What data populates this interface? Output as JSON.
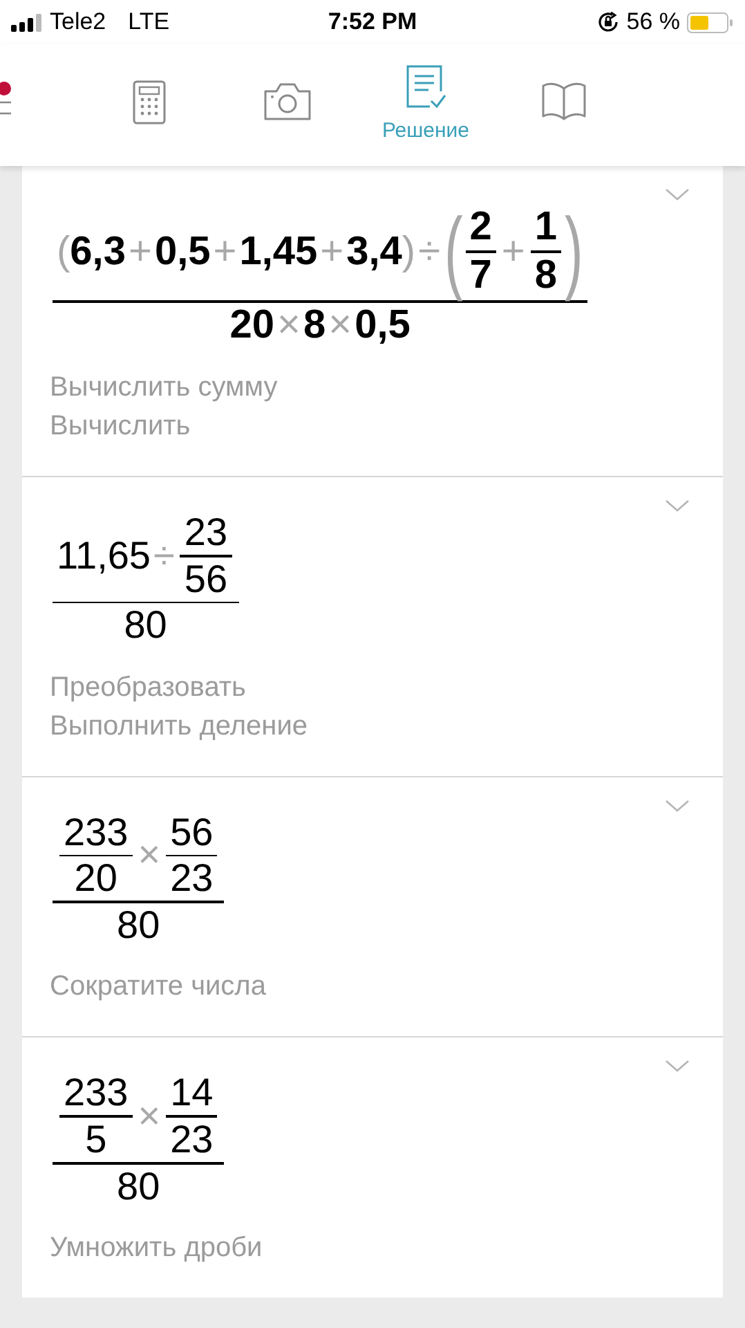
{
  "status_bar": {
    "carrier": "Tele2",
    "network": "LTE",
    "time": "7:52 PM",
    "battery": "56 %"
  },
  "toolbar": [
    {
      "kind": "menu",
      "selected": false
    },
    {
      "kind": "calculator",
      "selected": false
    },
    {
      "kind": "camera",
      "selected": false
    },
    {
      "kind": "solution",
      "label": "Решение",
      "selected": true
    },
    {
      "kind": "book",
      "selected": false
    }
  ],
  "steps": [
    {
      "bold": true,
      "expression": {
        "kind": "fraction",
        "num": [
          {
            "kind": "paren",
            "open": "(",
            "close": ")",
            "items": [
              {
                "kind": "number",
                "text": "6,3"
              },
              {
                "kind": "operator",
                "text": "+"
              },
              {
                "kind": "number",
                "text": "0,5"
              },
              {
                "kind": "operator",
                "text": "+"
              },
              {
                "kind": "number",
                "text": "1,45"
              },
              {
                "kind": "operator",
                "text": "+"
              },
              {
                "kind": "number",
                "text": "3,4"
              }
            ]
          },
          {
            "kind": "operator",
            "text": "÷"
          },
          {
            "kind": "paren",
            "open": "(",
            "close": ")",
            "items": [
              {
                "kind": "fraction",
                "num": [
                  {
                    "kind": "number",
                    "text": "2"
                  }
                ],
                "den": [
                  {
                    "kind": "number",
                    "text": "7"
                  }
                ]
              },
              {
                "kind": "operator",
                "text": "+"
              },
              {
                "kind": "fraction",
                "num": [
                  {
                    "kind": "number",
                    "text": "1"
                  }
                ],
                "den": [
                  {
                    "kind": "number",
                    "text": "8"
                  }
                ]
              }
            ]
          }
        ],
        "den": [
          {
            "kind": "number",
            "text": "20"
          },
          {
            "kind": "operator",
            "text": "×"
          },
          {
            "kind": "number",
            "text": "8"
          },
          {
            "kind": "operator",
            "text": "×"
          },
          {
            "kind": "number",
            "text": "0,5"
          }
        ]
      },
      "hints": [
        "Вычислить сумму",
        "Вычислить"
      ]
    },
    {
      "bold": false,
      "expression": {
        "kind": "fraction",
        "num": [
          {
            "kind": "number",
            "text": "11,65"
          },
          {
            "kind": "operator",
            "text": "÷"
          },
          {
            "kind": "fraction",
            "num": [
              {
                "kind": "number",
                "text": "23"
              }
            ],
            "den": [
              {
                "kind": "number",
                "text": "56"
              }
            ]
          }
        ],
        "den": [
          {
            "kind": "number",
            "text": "80"
          }
        ]
      },
      "hints": [
        "Преобразовать",
        "Выполнить деление"
      ]
    },
    {
      "bold": false,
      "expression": {
        "kind": "fraction",
        "num": [
          {
            "kind": "fraction",
            "num": [
              {
                "kind": "number",
                "text": "233"
              }
            ],
            "den": [
              {
                "kind": "number",
                "text": "20"
              }
            ]
          },
          {
            "kind": "operator",
            "text": "×"
          },
          {
            "kind": "fraction",
            "num": [
              {
                "kind": "number",
                "text": "56"
              }
            ],
            "den": [
              {
                "kind": "number",
                "text": "23"
              }
            ]
          }
        ],
        "den": [
          {
            "kind": "number",
            "text": "80"
          }
        ]
      },
      "hints": [
        "Сократите числа"
      ]
    },
    {
      "bold": false,
      "expression": {
        "kind": "fraction",
        "num": [
          {
            "kind": "fraction",
            "num": [
              {
                "kind": "number",
                "text": "233"
              }
            ],
            "den": [
              {
                "kind": "number",
                "text": "5"
              }
            ]
          },
          {
            "kind": "operator",
            "text": "×"
          },
          {
            "kind": "fraction",
            "num": [
              {
                "kind": "number",
                "text": "14"
              }
            ],
            "den": [
              {
                "kind": "number",
                "text": "23"
              }
            ]
          }
        ],
        "den": [
          {
            "kind": "number",
            "text": "80"
          }
        ]
      },
      "hints": [
        "Умножить дроби"
      ]
    }
  ]
}
